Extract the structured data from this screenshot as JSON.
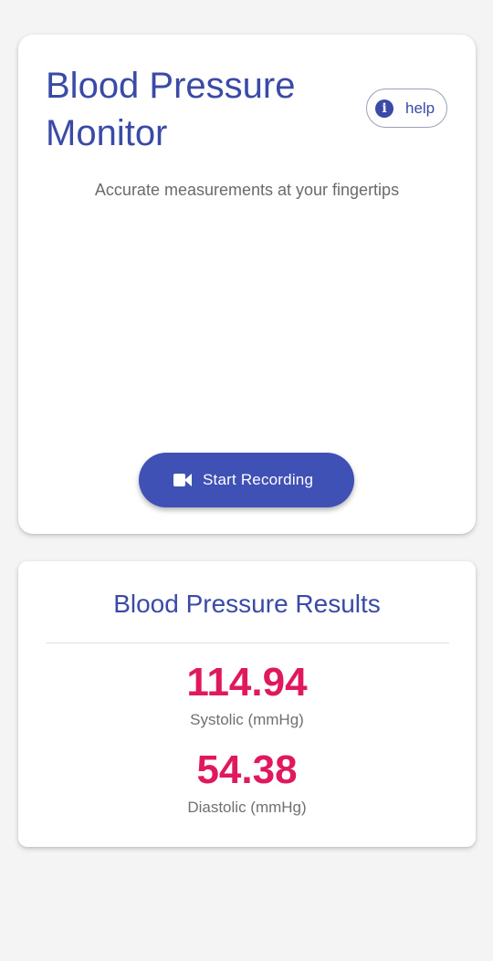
{
  "header": {
    "title": "Blood Pressure Monitor",
    "help_label": "help",
    "help_icon": "info-icon"
  },
  "main": {
    "subtitle": "Accurate measurements at your fingertips",
    "record_button_label": "Start Recording",
    "record_icon": "video-camera-icon"
  },
  "results": {
    "title": "Blood Pressure Results",
    "systolic": {
      "value": "114.94",
      "label": "Systolic (mmHg)"
    },
    "diastolic": {
      "value": "54.38",
      "label": "Diastolic (mmHg)"
    }
  },
  "colors": {
    "primary": "#3f51b5",
    "title_text": "#3a4aa6",
    "accent_value": "#e0195e",
    "background": "#f4f4f4"
  }
}
